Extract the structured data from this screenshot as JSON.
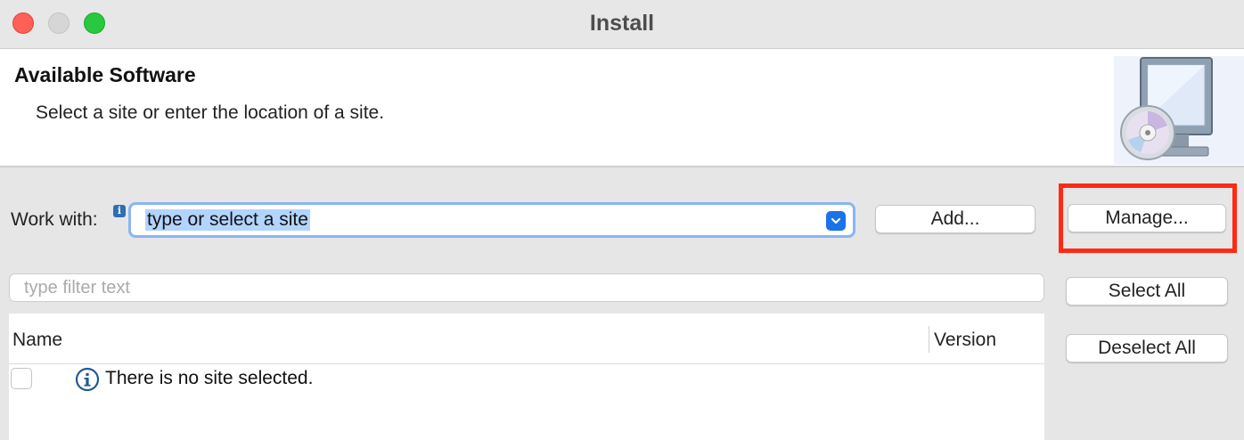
{
  "window": {
    "title": "Install",
    "controls": [
      "close",
      "minimize",
      "maximize"
    ]
  },
  "header": {
    "title": "Available Software",
    "description": "Select a site or enter the location of a site.",
    "image_icon": "monitor-with-cd-icon"
  },
  "work_with": {
    "label": "Work with:",
    "info_icon": "info-icon",
    "site_value": "type or select a site",
    "add_label": "Add...",
    "manage_label": "Manage..."
  },
  "filter": {
    "placeholder": "type filter text"
  },
  "table": {
    "columns": [
      "Name",
      "Version"
    ],
    "rows": [
      {
        "checked": false,
        "icon": "info-circle-icon",
        "name": "There is no site selected.",
        "version": ""
      }
    ]
  },
  "side_buttons": {
    "select_all": "Select All",
    "deselect_all": "Deselect All"
  },
  "colors": {
    "accent": "#1a73e8",
    "highlight": "#ff2a14",
    "selection": "#b3d4ff"
  }
}
